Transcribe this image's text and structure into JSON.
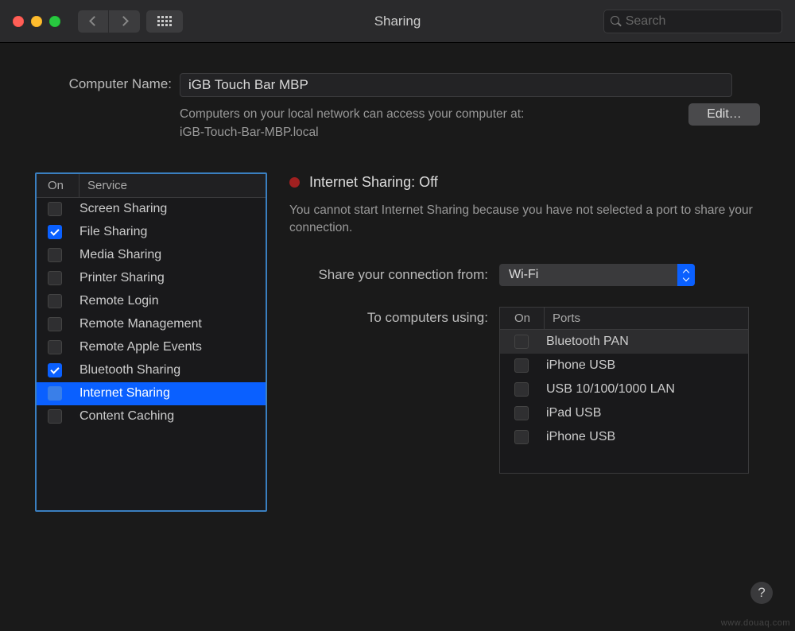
{
  "window": {
    "title": "Sharing",
    "search_placeholder": "Search"
  },
  "computer": {
    "label": "Computer Name:",
    "name": "iGB Touch Bar MBP",
    "desc_line1": "Computers on your local network can access your computer at:",
    "desc_line2": "iGB-Touch-Bar-MBP.local",
    "edit": "Edit…"
  },
  "services": {
    "header_on": "On",
    "header_name": "Service",
    "items": [
      {
        "name": "Screen Sharing",
        "checked": false,
        "selected": false
      },
      {
        "name": "File Sharing",
        "checked": true,
        "selected": false
      },
      {
        "name": "Media Sharing",
        "checked": false,
        "selected": false
      },
      {
        "name": "Printer Sharing",
        "checked": false,
        "selected": false
      },
      {
        "name": "Remote Login",
        "checked": false,
        "selected": false
      },
      {
        "name": "Remote Management",
        "checked": false,
        "selected": false
      },
      {
        "name": "Remote Apple Events",
        "checked": false,
        "selected": false
      },
      {
        "name": "Bluetooth Sharing",
        "checked": true,
        "selected": false
      },
      {
        "name": "Internet Sharing",
        "checked": false,
        "selected": true
      },
      {
        "name": "Content Caching",
        "checked": false,
        "selected": false
      }
    ]
  },
  "detail": {
    "status_title": "Internet Sharing: Off",
    "status_msg": "You cannot start Internet Sharing because you have not selected a port to share your connection.",
    "share_from_label": "Share your connection from:",
    "share_from_value": "Wi-Fi",
    "to_using_label": "To computers using:",
    "ports": {
      "header_on": "On",
      "header_name": "Ports",
      "items": [
        {
          "name": "Bluetooth PAN",
          "checked": false,
          "hl": true
        },
        {
          "name": "iPhone USB",
          "checked": false,
          "hl": false
        },
        {
          "name": "USB 10/100/1000 LAN",
          "checked": false,
          "hl": false
        },
        {
          "name": "iPad USB",
          "checked": false,
          "hl": false
        },
        {
          "name": "iPhone USB",
          "checked": false,
          "hl": false
        }
      ]
    }
  },
  "help": "?",
  "watermark": "www.douaq.com"
}
